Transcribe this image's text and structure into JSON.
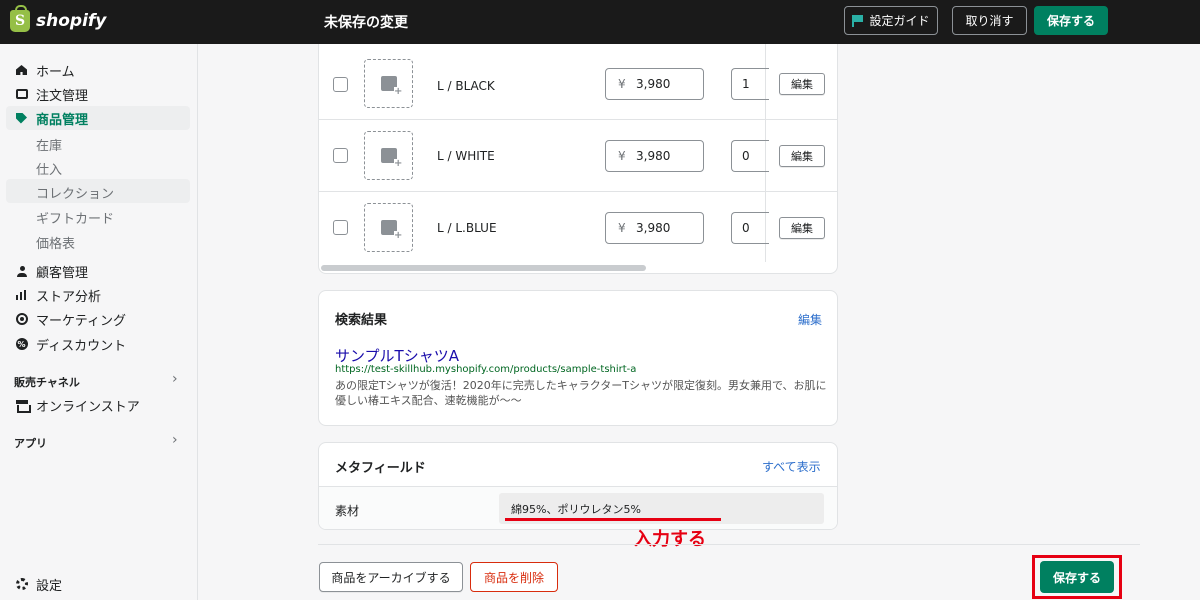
{
  "topbar": {
    "logo_mark": "S",
    "logo_text": "shopify",
    "status": "未保存の変更",
    "guide_label": "設定ガイド",
    "cancel_label": "取り消す",
    "save_label": "保存する"
  },
  "sidebar": {
    "items": [
      {
        "label": "ホーム",
        "icon": "home-icon"
      },
      {
        "label": "注文管理",
        "icon": "inbox-icon"
      },
      {
        "label": "商品管理",
        "icon": "tag-icon"
      },
      {
        "label": "顧客管理",
        "icon": "user-icon"
      },
      {
        "label": "ストア分析",
        "icon": "bar-chart-icon"
      },
      {
        "label": "マーケティング",
        "icon": "target-icon"
      },
      {
        "label": "ディスカウント",
        "icon": "discount-icon"
      }
    ],
    "product_subitems": [
      "在庫",
      "仕入",
      "コレクション",
      "ギフトカード",
      "価格表"
    ],
    "sales_channels_label": "販売チャネル",
    "online_store_label": "オンラインストア",
    "apps_label": "アプリ",
    "settings_label": "設定"
  },
  "variants": {
    "rows": [
      {
        "name": "L / BLACK",
        "currency": "¥",
        "price": "3,980",
        "quantity": "1",
        "edit_label": "編集"
      },
      {
        "name": "L / WHITE",
        "currency": "¥",
        "price": "3,980",
        "quantity": "0",
        "edit_label": "編集"
      },
      {
        "name": "L / L.BLUE",
        "currency": "¥",
        "price": "3,980",
        "quantity": "0",
        "edit_label": "編集"
      }
    ]
  },
  "seo": {
    "heading": "検索結果",
    "edit_label": "編集",
    "title": "サンプルTシャツA",
    "url": "https://test-skillhub.myshopify.com/products/sample-tshirt-a",
    "description": "あの限定Tシャツが復活！2020年に完売したキャラクターTシャツが限定復刻。男女兼用で、お肌に優しい椿エキス配合、速乾機能が〜〜"
  },
  "metafields": {
    "heading": "メタフィールド",
    "show_all_label": "すべて表示",
    "field_label": "素材",
    "field_value": "綿95%、ポリウレタン5%"
  },
  "annotation": {
    "text": "入力する",
    "color": "#e60012"
  },
  "footer": {
    "archive_label": "商品をアーカイブする",
    "delete_label": "商品を削除",
    "save_label": "保存する"
  },
  "colors": {
    "primary": "#008060",
    "link": "#2c6ecb",
    "danger": "#d82c0d",
    "highlight": "#e60012"
  }
}
